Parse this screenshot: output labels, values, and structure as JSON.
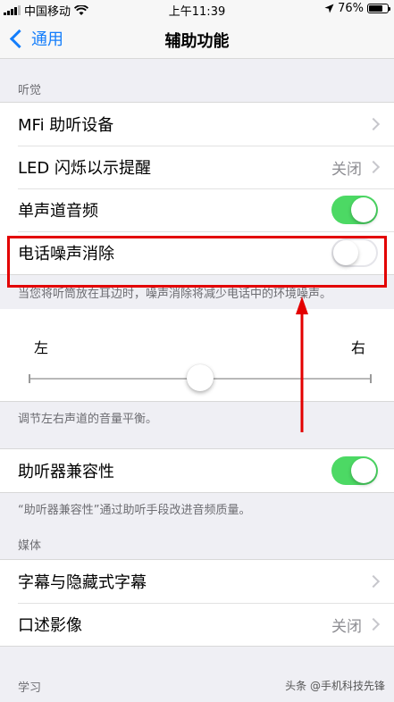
{
  "status": {
    "carrier": "中国移动",
    "time": "上午11:39",
    "battery_pct": "76%",
    "battery_level": 0.76
  },
  "nav": {
    "back_label": "通用",
    "title": "辅助功能"
  },
  "sections": {
    "hearing_header": "听觉",
    "media_header": "媒体",
    "learning_header": "学习"
  },
  "hearing": {
    "mfi_label": "MFi 助听设备",
    "led_label": "LED 闪烁以示提醒",
    "led_value": "关闭",
    "mono_label": "单声道音频",
    "mono_on": true,
    "noise_label": "电话噪声消除",
    "noise_on": false,
    "noise_footnote": "当您将听筒放在耳边时，噪声消除将减少电话中的环境噪声。"
  },
  "balance": {
    "left_label": "左",
    "right_label": "右",
    "value": 0.5,
    "footnote": "调节左右声道的音量平衡。"
  },
  "hac": {
    "label": "助听器兼容性",
    "on": true,
    "footnote": "“助听器兼容性”通过助听手段改进音频质量。"
  },
  "media": {
    "subtitles_label": "字幕与隐藏式字幕",
    "audio_desc_label": "口述影像",
    "audio_desc_value": "关闭"
  },
  "annotation": {
    "highlight_color": "#e30000"
  },
  "watermark": "头条 @手机科技先锋",
  "colors": {
    "accent": "#147efb",
    "toggle_on": "#4cd964"
  }
}
